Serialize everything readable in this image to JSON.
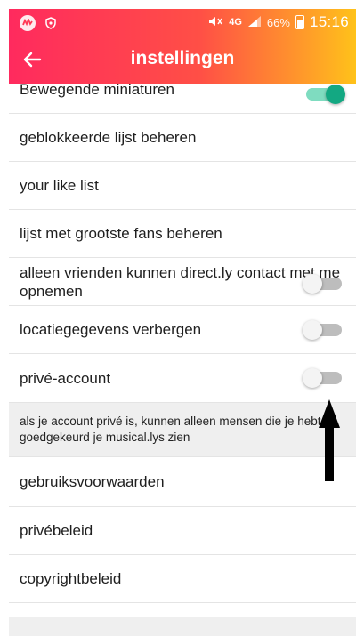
{
  "status_bar": {
    "network": "4G",
    "battery": "66%",
    "time": "15:16",
    "icons": [
      "app-icon",
      "shield-icon",
      "mute-icon",
      "signal-icon",
      "battery-icon"
    ]
  },
  "header": {
    "title": "instellingen",
    "back_icon": "arrow-left-icon",
    "gradient_colors": [
      "#ff2a5e",
      "#ff4f46",
      "#ff9a2a",
      "#ffc21a"
    ]
  },
  "settings": [
    {
      "label": "Bewegende miniaturen",
      "toggle": "on"
    },
    {
      "label": "geblokkeerde lijst beheren"
    },
    {
      "label": "your like list"
    },
    {
      "label": "lijst met grootste fans beheren"
    },
    {
      "label": "alleen vrienden kunnen direct.ly contact met me opnemen",
      "toggle": "off"
    },
    {
      "label": "locatiegegevens verbergen",
      "toggle": "off"
    },
    {
      "label": "privé-account",
      "toggle": "off"
    }
  ],
  "private_note": "als je account privé is, kunnen alleen mensen die je hebt goedgekeurd je musical.lys zien",
  "links": [
    {
      "label": "gebruiksvoorwaarden"
    },
    {
      "label": "privébeleid"
    },
    {
      "label": "copyrightbeleid"
    }
  ],
  "accent_color": "#13a882"
}
